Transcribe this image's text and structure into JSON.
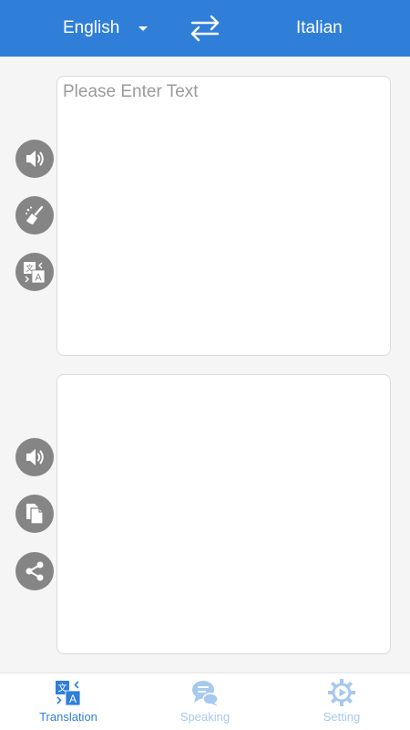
{
  "header": {
    "source_language": "English",
    "target_language": "Italian"
  },
  "input": {
    "placeholder": "Please Enter Text",
    "value": ""
  },
  "output": {
    "value": ""
  },
  "input_controls": [
    {
      "icon": "speaker-icon"
    },
    {
      "icon": "broom-icon"
    },
    {
      "icon": "translate-icon"
    }
  ],
  "output_controls": [
    {
      "icon": "speaker-icon"
    },
    {
      "icon": "copy-icon"
    },
    {
      "icon": "share-icon"
    }
  ],
  "tabs": [
    {
      "label": "Translation",
      "icon": "translate-icon",
      "active": true
    },
    {
      "label": "Speaking",
      "icon": "chat-bubbles-icon",
      "active": false
    },
    {
      "label": "Setting",
      "icon": "gear-icon",
      "active": false
    }
  ],
  "colors": {
    "primary": "#2f7fd9",
    "control_gray": "#858585",
    "inactive_tab": "#a8c9ee",
    "background": "#f5f5f5"
  }
}
